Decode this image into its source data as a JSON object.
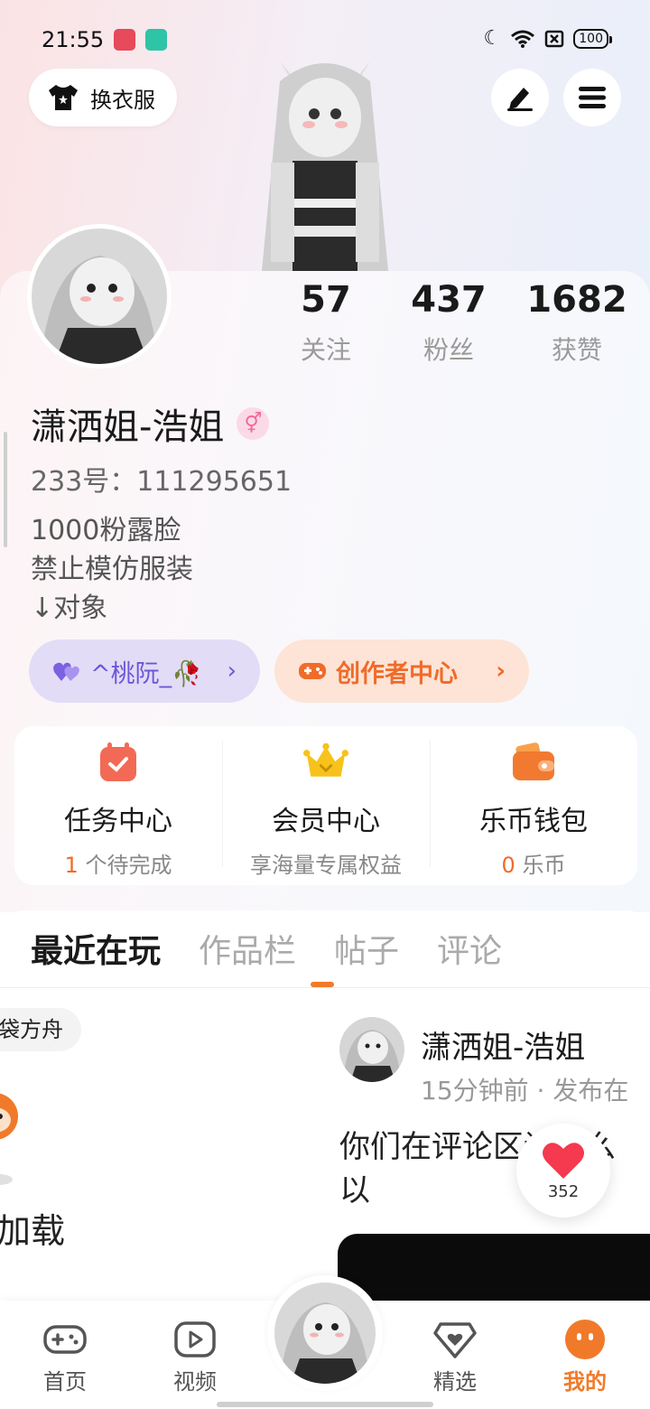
{
  "status_bar": {
    "time": "21:55",
    "battery": "100"
  },
  "header": {
    "outfit_label": "换衣服"
  },
  "profile": {
    "username": "潇洒姐-浩姐",
    "gender_symbol": "⚥",
    "id_text": "233号：111295651",
    "bio": [
      "1000粉露脸",
      "禁止模仿服装",
      "↓对象"
    ]
  },
  "stats": [
    {
      "value": "57",
      "label": "关注"
    },
    {
      "value": "437",
      "label": "粉丝"
    },
    {
      "value": "1682",
      "label": "获赞"
    }
  ],
  "chips": {
    "tag_label": "^桃阮_🥀",
    "creator_label": "创作者中心"
  },
  "services": [
    {
      "title": "任务中心",
      "highlight": "1",
      "sub": " 个待完成"
    },
    {
      "title": "会员中心",
      "highlight": "",
      "sub": "享海量专属权益"
    },
    {
      "title": "乐币钱包",
      "highlight": "0",
      "sub": " 乐币"
    }
  ],
  "tabs": [
    "最近在玩",
    "作品栏",
    "帖子",
    "评论"
  ],
  "left_card": {
    "game_name": "袋方舟",
    "loading": "加载"
  },
  "post": {
    "author": "潇洒姐-浩姐",
    "meta": "15分钟前 · 发布在",
    "body_line1": "你们在评论区说什么",
    "body_line2": "以",
    "like_count": "352"
  },
  "bottom_nav": [
    {
      "label": "首页",
      "icon": "gamepad-icon"
    },
    {
      "label": "视频",
      "icon": "play-icon"
    },
    {
      "label": "精选",
      "icon": "heart-diamond-icon"
    },
    {
      "label": "我的",
      "icon": "face-icon"
    }
  ],
  "colors": {
    "accent": "#f07a2a",
    "purple": "#6d57d6",
    "pink_gender": "#f06a9a"
  }
}
